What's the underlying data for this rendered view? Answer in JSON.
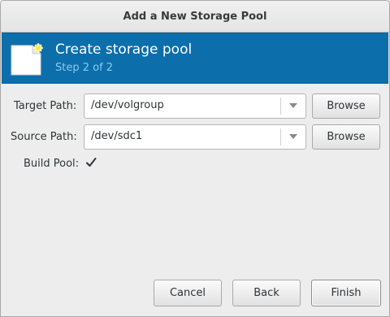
{
  "window": {
    "title": "Add a New Storage Pool"
  },
  "banner": {
    "title": "Create storage pool",
    "step": "Step 2 of 2",
    "icon": "new-document-icon",
    "color": "#0c6eab"
  },
  "form": {
    "target_path": {
      "label": "Target Path:",
      "value": "/dev/volgroup",
      "browse_label": "Browse"
    },
    "source_path": {
      "label": "Source Path:",
      "value": "/dev/sdc1",
      "browse_label": "Browse"
    },
    "build_pool": {
      "label": "Build Pool:",
      "checked": true
    }
  },
  "buttons": {
    "cancel": "Cancel",
    "back": "Back",
    "finish": "Finish"
  }
}
